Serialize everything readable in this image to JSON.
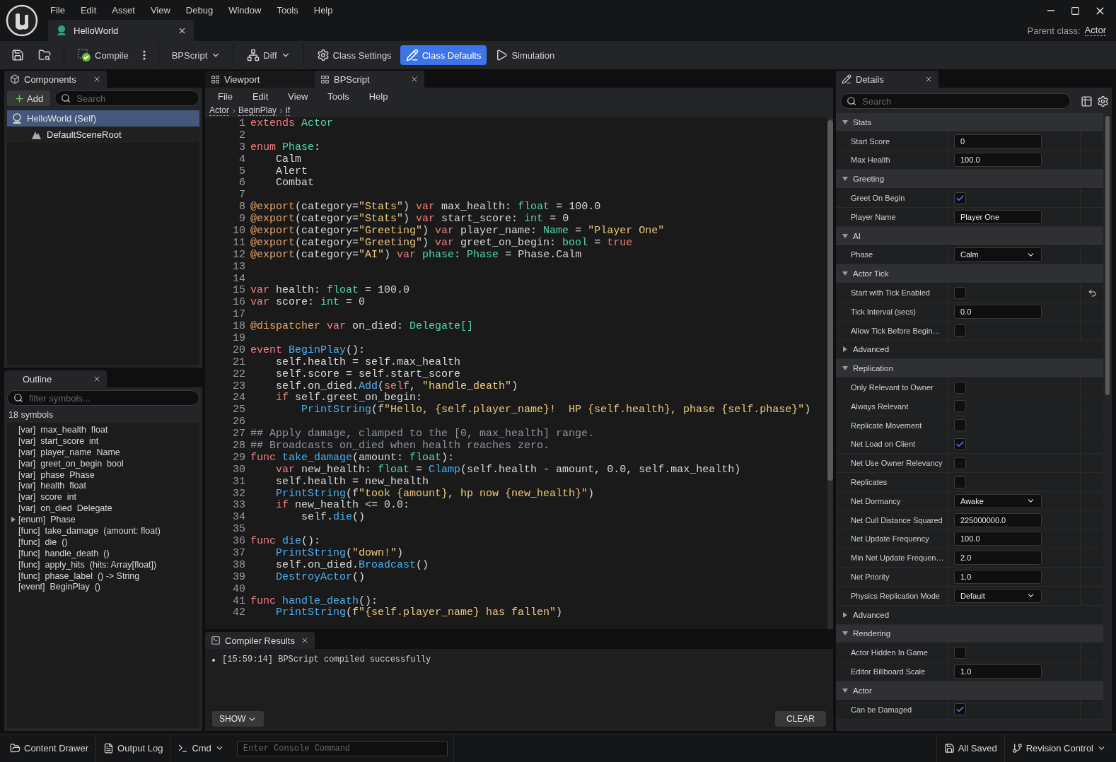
{
  "window": {
    "menu": [
      "File",
      "Edit",
      "Asset",
      "View",
      "Debug",
      "Window",
      "Tools",
      "Help"
    ],
    "document_tab": {
      "label": "HelloWorld"
    },
    "parent_class_label": "Parent class:",
    "parent_class": "Actor"
  },
  "toolbar": [
    {
      "kind": "save"
    },
    {
      "kind": "browse"
    },
    {
      "kind": "compile",
      "label": "Compile"
    },
    {
      "kind": "more"
    },
    {
      "kind": "dropdown",
      "label": "BPScript"
    },
    {
      "kind": "diff",
      "label": "Diff"
    },
    {
      "kind": "settings",
      "label": "Class Settings",
      "selected": false
    },
    {
      "kind": "defaults",
      "label": "Class Defaults",
      "selected": true
    },
    {
      "kind": "simulation",
      "label": "Simulation",
      "selected": false
    }
  ],
  "components": {
    "tab": "Components",
    "add_label": "Add",
    "search_placeholder": "Search",
    "tree": [
      {
        "label": "HelloWorld (Self)",
        "selected": true,
        "children": [
          {
            "label": "DefaultSceneRoot",
            "selected": false
          }
        ]
      }
    ]
  },
  "outline": {
    "tab": "Outline",
    "filter_placeholder": "filter symbols...",
    "count": "18 symbols",
    "items": [
      {
        "tag": "[var]",
        "name": "max_health",
        "sig": "float"
      },
      {
        "tag": "[var]",
        "name": "start_score",
        "sig": "int"
      },
      {
        "tag": "[var]",
        "name": "player_name",
        "sig": "Name"
      },
      {
        "tag": "[var]",
        "name": "greet_on_begin",
        "sig": "bool"
      },
      {
        "tag": "[var]",
        "name": "phase",
        "sig": "Phase"
      },
      {
        "tag": "[var]",
        "name": "health",
        "sig": "float"
      },
      {
        "tag": "[var]",
        "name": "score",
        "sig": "int"
      },
      {
        "tag": "[var]",
        "name": "on_died",
        "sig": "Delegate"
      },
      {
        "tag": "[enum]",
        "name": "Phase",
        "expanded": false
      },
      {
        "tag": "[func]",
        "name": "take_damage",
        "sig": "(amount: float)"
      },
      {
        "tag": "[func]",
        "name": "die",
        "sig": "()"
      },
      {
        "tag": "[func]",
        "name": "handle_death",
        "sig": "()"
      },
      {
        "tag": "[func]",
        "name": "apply_hits",
        "sig": "(hits: Array[float])"
      },
      {
        "tag": "[func]",
        "name": "phase_label",
        "sig": "() -> String"
      },
      {
        "tag": "[event]",
        "name": "BeginPlay",
        "sig": "()"
      }
    ]
  },
  "editor_tabs": [
    {
      "label": "Viewport",
      "selected": false
    },
    {
      "label": "BPScript",
      "selected": true
    }
  ],
  "editor_menu": [
    "File",
    "Edit",
    "View",
    "Tools",
    "Help"
  ],
  "breadcrumb": [
    "Actor",
    "BeginPlay",
    "if"
  ],
  "code": [
    {
      "n": "1",
      "tokens": [
        {
          "kind": "kw",
          "text": "extends "
        },
        {
          "kind": "type",
          "text": "Actor"
        }
      ]
    },
    {
      "n": "2"
    },
    {
      "n": "3",
      "tokens": [
        {
          "kind": "kw",
          "text": "enum "
        },
        {
          "kind": "type",
          "text": "Phase"
        },
        {
          "kind": "plain",
          "text": ":"
        }
      ]
    },
    {
      "n": "4",
      "tokens": [
        {
          "kind": "plain",
          "text": "    Calm"
        }
      ]
    },
    {
      "n": "5",
      "tokens": [
        {
          "kind": "plain",
          "text": "    Alert"
        }
      ]
    },
    {
      "n": "6",
      "tokens": [
        {
          "kind": "plain",
          "text": "    Combat"
        }
      ]
    },
    {
      "n": "7"
    },
    {
      "n": "8",
      "tokens": [
        {
          "kind": "deco",
          "text": "@export"
        },
        {
          "kind": "plain",
          "text": "(category="
        },
        {
          "kind": "str",
          "text": "\"Stats\""
        },
        {
          "kind": "plain",
          "text": ") "
        },
        {
          "kind": "kw",
          "text": "var"
        },
        {
          "kind": "plain",
          "text": " max_health: "
        },
        {
          "kind": "type",
          "text": "float"
        },
        {
          "kind": "plain",
          "text": " = 100.0"
        }
      ]
    },
    {
      "n": "9",
      "tokens": [
        {
          "kind": "deco",
          "text": "@export"
        },
        {
          "kind": "plain",
          "text": "(category="
        },
        {
          "kind": "str",
          "text": "\"Stats\""
        },
        {
          "kind": "plain",
          "text": ") "
        },
        {
          "kind": "kw",
          "text": "var"
        },
        {
          "kind": "plain",
          "text": " start_score: "
        },
        {
          "kind": "type",
          "text": "int"
        },
        {
          "kind": "plain",
          "text": " = 0"
        }
      ]
    },
    {
      "n": "10",
      "tokens": [
        {
          "kind": "deco",
          "text": "@export"
        },
        {
          "kind": "plain",
          "text": "(category="
        },
        {
          "kind": "str",
          "text": "\"Greeting\""
        },
        {
          "kind": "plain",
          "text": ") "
        },
        {
          "kind": "kw",
          "text": "var"
        },
        {
          "kind": "plain",
          "text": " player_name: "
        },
        {
          "kind": "type",
          "text": "Name"
        },
        {
          "kind": "plain",
          "text": " = "
        },
        {
          "kind": "str",
          "text": "\"Player One\""
        }
      ]
    },
    {
      "n": "11",
      "tokens": [
        {
          "kind": "deco",
          "text": "@export"
        },
        {
          "kind": "plain",
          "text": "(category="
        },
        {
          "kind": "str",
          "text": "\"Greeting\""
        },
        {
          "kind": "plain",
          "text": ") "
        },
        {
          "kind": "kw",
          "text": "var"
        },
        {
          "kind": "plain",
          "text": " greet_on_begin: "
        },
        {
          "kind": "type",
          "text": "bool"
        },
        {
          "kind": "plain",
          "text": " = "
        },
        {
          "kind": "kw",
          "text": "true"
        }
      ]
    },
    {
      "n": "12",
      "tokens": [
        {
          "kind": "deco",
          "text": "@export"
        },
        {
          "kind": "plain",
          "text": "(category="
        },
        {
          "kind": "str",
          "text": "\"AI\""
        },
        {
          "kind": "plain",
          "text": ") "
        },
        {
          "kind": "kw",
          "text": "var "
        },
        {
          "kind": "type",
          "text": "phase"
        },
        {
          "kind": "plain",
          "text": ": "
        },
        {
          "kind": "type",
          "text": "Phase"
        },
        {
          "kind": "plain",
          "text": " = Phase.Calm"
        }
      ]
    },
    {
      "n": "13"
    },
    {
      "n": "14"
    },
    {
      "n": "15",
      "tokens": [
        {
          "kind": "kw",
          "text": "var"
        },
        {
          "kind": "plain",
          "text": " health: "
        },
        {
          "kind": "type",
          "text": "float"
        },
        {
          "kind": "plain",
          "text": " = 100.0"
        }
      ]
    },
    {
      "n": "16",
      "tokens": [
        {
          "kind": "kw",
          "text": "var"
        },
        {
          "kind": "plain",
          "text": " score: "
        },
        {
          "kind": "type",
          "text": "int"
        },
        {
          "kind": "plain",
          "text": " = 0"
        }
      ]
    },
    {
      "n": "17"
    },
    {
      "n": "18",
      "tokens": [
        {
          "kind": "deco",
          "text": "@dispatcher "
        },
        {
          "kind": "kw",
          "text": "var"
        },
        {
          "kind": "plain",
          "text": " on_died: "
        },
        {
          "kind": "type",
          "text": "Delegate[]"
        }
      ]
    },
    {
      "n": "19"
    },
    {
      "n": "20",
      "tokens": [
        {
          "kind": "kw",
          "text": "event "
        },
        {
          "kind": "fn",
          "text": "BeginPlay"
        },
        {
          "kind": "plain",
          "text": "():"
        }
      ]
    },
    {
      "n": "21",
      "tokens": [
        {
          "kind": "plain",
          "text": "    self.health = self.max_health"
        }
      ]
    },
    {
      "n": "22",
      "tokens": [
        {
          "kind": "plain",
          "text": "    self.score = self.start_score"
        }
      ]
    },
    {
      "n": "23",
      "tokens": [
        {
          "kind": "plain",
          "text": "    self.on_died."
        },
        {
          "kind": "fn",
          "text": "Add"
        },
        {
          "kind": "plain",
          "text": "("
        },
        {
          "kind": "kw",
          "text": "self"
        },
        {
          "kind": "plain",
          "text": ", "
        },
        {
          "kind": "str",
          "text": "\"handle_death\""
        },
        {
          "kind": "plain",
          "text": ")"
        }
      ]
    },
    {
      "n": "24",
      "tokens": [
        {
          "kind": "kw",
          "text": "    if"
        },
        {
          "kind": "plain",
          "text": " self.greet_on_begin:"
        }
      ]
    },
    {
      "n": "25",
      "tokens": [
        {
          "kind": "fn",
          "text": "        PrintString"
        },
        {
          "kind": "plain",
          "text": "(f"
        },
        {
          "kind": "str",
          "text": "\"Hello, {self.player_name}!  HP {self.health}, phase {self.phase}\""
        },
        {
          "kind": "plain",
          "text": ")"
        }
      ]
    },
    {
      "n": "26"
    },
    {
      "n": "27",
      "tokens": [
        {
          "kind": "comment",
          "text": "## Apply damage, clamped to the [0, max_health] range."
        }
      ]
    },
    {
      "n": "28",
      "tokens": [
        {
          "kind": "comment",
          "text": "## Broadcasts on_died when health reaches zero."
        }
      ]
    },
    {
      "n": "29",
      "tokens": [
        {
          "kind": "kw",
          "text": "func "
        },
        {
          "kind": "fn",
          "text": "take_damage"
        },
        {
          "kind": "plain",
          "text": "(amount: "
        },
        {
          "kind": "type",
          "text": "float"
        },
        {
          "kind": "plain",
          "text": "):"
        }
      ]
    },
    {
      "n": "30",
      "tokens": [
        {
          "kind": "kw",
          "text": "    var"
        },
        {
          "kind": "plain",
          "text": " new_health: "
        },
        {
          "kind": "type",
          "text": "float"
        },
        {
          "kind": "plain",
          "text": " = "
        },
        {
          "kind": "fn",
          "text": "Clamp"
        },
        {
          "kind": "plain",
          "text": "(self.health - amount, 0.0, self.max_health)"
        }
      ]
    },
    {
      "n": "31",
      "tokens": [
        {
          "kind": "plain",
          "text": "    self.health = new_health"
        }
      ]
    },
    {
      "n": "32",
      "tokens": [
        {
          "kind": "fn",
          "text": "    PrintString"
        },
        {
          "kind": "plain",
          "text": "(f"
        },
        {
          "kind": "str",
          "text": "\"took {amount}, hp now {new_health}\""
        },
        {
          "kind": "plain",
          "text": ")"
        }
      ]
    },
    {
      "n": "33",
      "tokens": [
        {
          "kind": "kw",
          "text": "    if"
        },
        {
          "kind": "plain",
          "text": " new_health <= 0.0:"
        }
      ]
    },
    {
      "n": "34",
      "tokens": [
        {
          "kind": "plain",
          "text": "        self."
        },
        {
          "kind": "fn",
          "text": "die"
        },
        {
          "kind": "plain",
          "text": "()"
        }
      ]
    },
    {
      "n": "35"
    },
    {
      "n": "36",
      "tokens": [
        {
          "kind": "kw",
          "text": "func "
        },
        {
          "kind": "fn",
          "text": "die"
        },
        {
          "kind": "plain",
          "text": "():"
        }
      ]
    },
    {
      "n": "37",
      "tokens": [
        {
          "kind": "fn",
          "text": "    PrintString"
        },
        {
          "kind": "plain",
          "text": "("
        },
        {
          "kind": "str",
          "text": "\"down!\""
        },
        {
          "kind": "plain",
          "text": ")"
        }
      ]
    },
    {
      "n": "38",
      "tokens": [
        {
          "kind": "plain",
          "text": "    self.on_died."
        },
        {
          "kind": "fn",
          "text": "Broadcast"
        },
        {
          "kind": "plain",
          "text": "()"
        }
      ]
    },
    {
      "n": "39",
      "tokens": [
        {
          "kind": "fn",
          "text": "    DestroyActor"
        },
        {
          "kind": "plain",
          "text": "()"
        }
      ]
    },
    {
      "n": "40"
    },
    {
      "n": "41",
      "tokens": [
        {
          "kind": "kw",
          "text": "func "
        },
        {
          "kind": "fn",
          "text": "handle_death"
        },
        {
          "kind": "plain",
          "text": "():"
        }
      ]
    },
    {
      "n": "42",
      "tokens": [
        {
          "kind": "fn",
          "text": "    PrintString"
        },
        {
          "kind": "plain",
          "text": "(f"
        },
        {
          "kind": "str",
          "text": "\"{self.player_name} has fallen\""
        },
        {
          "kind": "plain",
          "text": ")"
        }
      ]
    }
  ],
  "compiler": {
    "tab": "Compiler Results",
    "messages": [
      "[15:59:14] BPScript compiled successfully"
    ],
    "show_label": "SHOW",
    "clear_label": "CLEAR"
  },
  "details": {
    "tab": "Details",
    "search_placeholder": "Search",
    "sections": [
      {
        "title": "Stats",
        "expanded": true,
        "rows": [
          {
            "kind": "field",
            "label": "Start Score",
            "value": "0"
          },
          {
            "kind": "field",
            "label": "Max Health",
            "value": "100.0"
          }
        ]
      },
      {
        "title": "Greeting",
        "expanded": true,
        "rows": [
          {
            "kind": "check",
            "label": "Greet On Begin",
            "checked": true
          },
          {
            "kind": "field",
            "label": "Player Name",
            "value": "Player One"
          }
        ]
      },
      {
        "title": "AI",
        "expanded": true,
        "rows": [
          {
            "kind": "select",
            "label": "Phase",
            "value": "Calm"
          }
        ]
      },
      {
        "title": "Actor Tick",
        "expanded": true,
        "rows": [
          {
            "kind": "check",
            "label": "Start with Tick Enabled",
            "checked": false,
            "reset": true
          },
          {
            "kind": "field",
            "label": "Tick Interval (secs)",
            "value": "0.0"
          },
          {
            "kind": "check",
            "label": "Allow Tick Before Begin…",
            "checked": false
          },
          {
            "kind": "subgroup",
            "label": "Advanced",
            "expanded": false
          }
        ]
      },
      {
        "title": "Replication",
        "expanded": true,
        "rows": [
          {
            "kind": "check",
            "label": "Only Relevant to Owner",
            "checked": false
          },
          {
            "kind": "check",
            "label": "Always Relevant",
            "checked": false
          },
          {
            "kind": "check",
            "label": "Replicate Movement",
            "checked": false
          },
          {
            "kind": "check",
            "label": "Net Load on Client",
            "checked": true
          },
          {
            "kind": "check",
            "label": "Net Use Owner Relevancy",
            "checked": false
          },
          {
            "kind": "check",
            "label": "Replicates",
            "checked": false
          },
          {
            "kind": "select",
            "label": "Net Dormancy",
            "value": "Awake"
          },
          {
            "kind": "field",
            "label": "Net Cull Distance Squared",
            "value": "225000000.0"
          },
          {
            "kind": "field",
            "label": "Net Update Frequency",
            "value": "100.0"
          },
          {
            "kind": "field",
            "label": "Min Net Update Frequen…",
            "value": "2.0"
          },
          {
            "kind": "field",
            "label": "Net Priority",
            "value": "1.0"
          },
          {
            "kind": "select",
            "label": "Physics Replication Mode",
            "value": "Default"
          },
          {
            "kind": "subgroup",
            "label": "Advanced",
            "expanded": false
          }
        ]
      },
      {
        "title": "Rendering",
        "expanded": true,
        "rows": [
          {
            "kind": "check",
            "label": "Actor Hidden In Game",
            "checked": false
          },
          {
            "kind": "field",
            "label": "Editor Billboard Scale",
            "value": "1.0"
          }
        ]
      },
      {
        "title": "Actor",
        "expanded": true,
        "rows": [
          {
            "kind": "check",
            "label": "Can be Damaged",
            "checked": true
          }
        ]
      }
    ]
  },
  "status_bar": {
    "content_drawer": "Content Drawer",
    "output_log": "Output Log",
    "cmd": "Cmd",
    "console_placeholder": "Enter Console Command",
    "saved": "All Saved",
    "revision": "Revision Control"
  }
}
